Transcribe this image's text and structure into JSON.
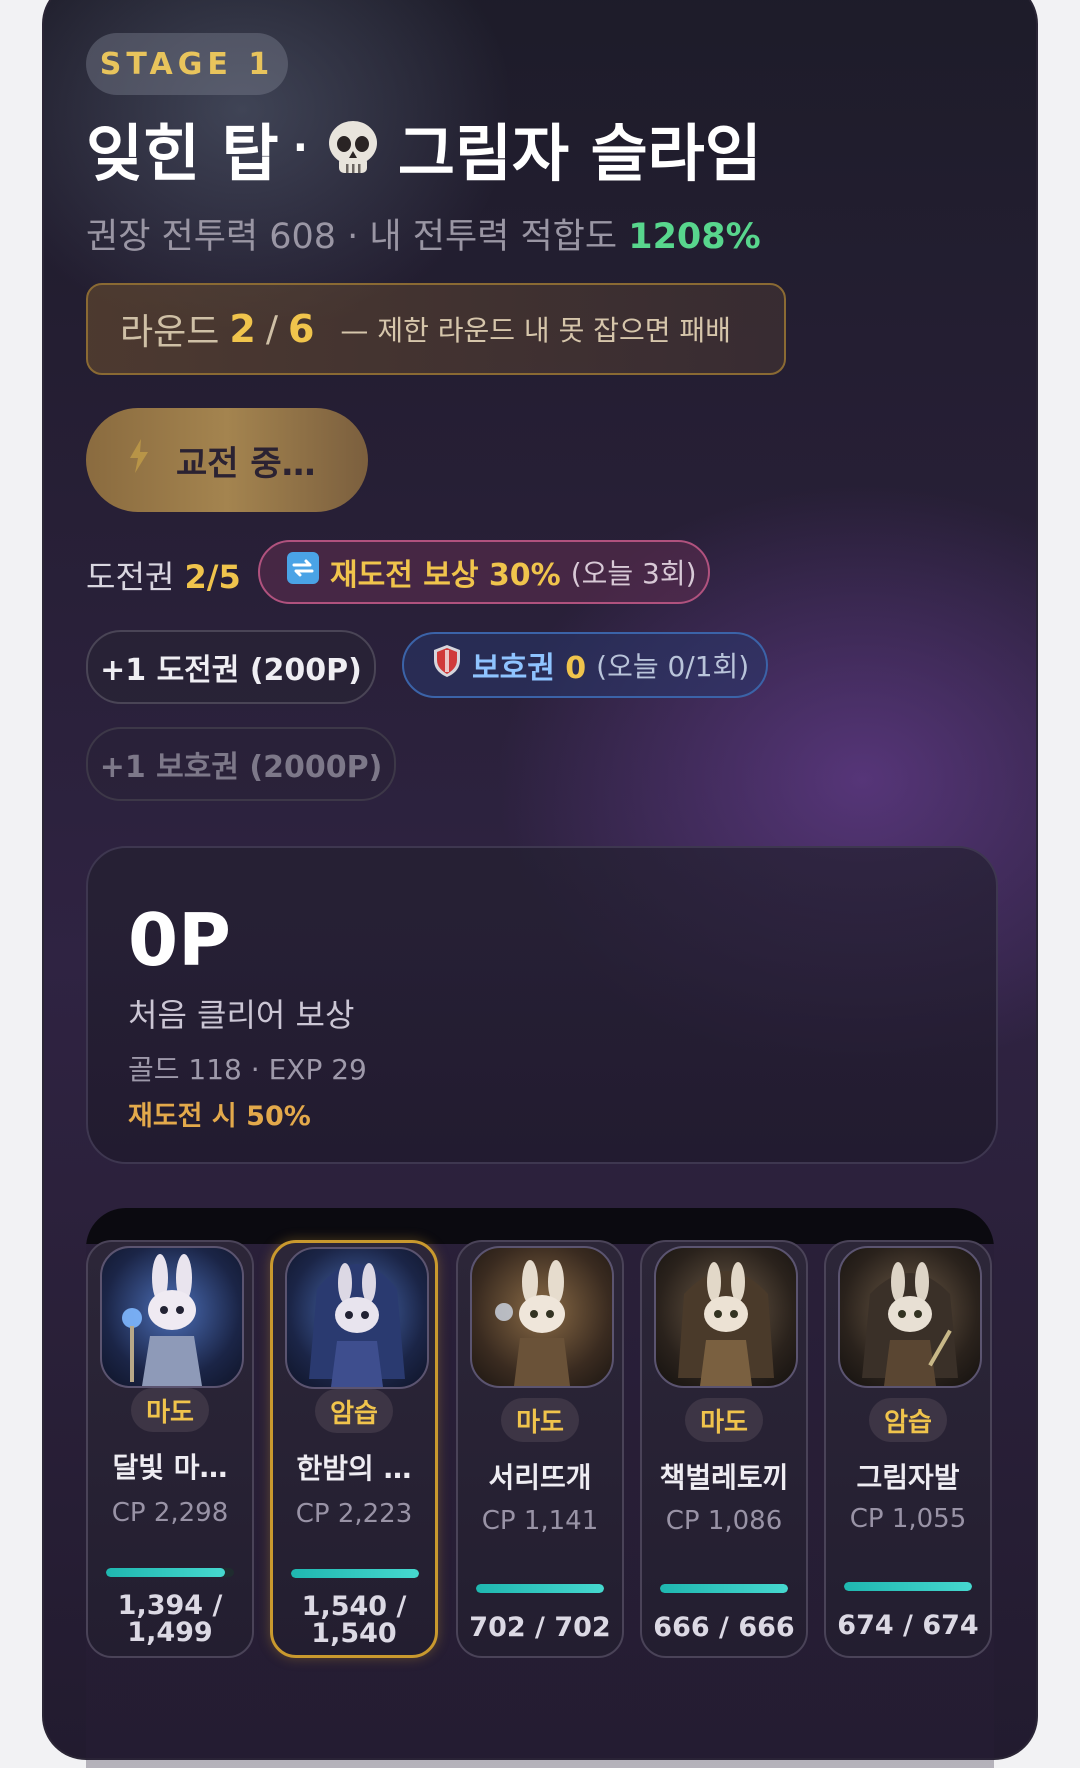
{
  "stage": {
    "badge": "STAGE 1"
  },
  "title": {
    "part1": "잊힌 탑",
    "separator": "·",
    "icon": "skull-icon",
    "part2": "그림자 슬라임"
  },
  "subtitle": {
    "text": "권장 전투력 608 · 내 전투력 적합도 ",
    "fit": "1208%"
  },
  "round": {
    "label": "라운드",
    "current": "2",
    "sep": "/",
    "max": "6",
    "note": "— 제한 라운드 내 못 잡으면 패배"
  },
  "battle_button": {
    "label": "교전 중…",
    "icon": "lightning-icon"
  },
  "tickets": {
    "label": "도전권",
    "value": "2/5"
  },
  "retry_reward": {
    "icon": "repeat-icon",
    "label": "재도전 보상 30%",
    "sub": "(오늘 3회)"
  },
  "buy_ticket": {
    "label": "+1 도전권 (200P)"
  },
  "guard": {
    "icon": "shield-icon",
    "label": "보호권",
    "value": "0",
    "sub": "(오늘 0/1회)"
  },
  "buy_guard": {
    "label": "+1 보호권 (2000P)"
  },
  "reward": {
    "points": "0P",
    "label": "처음 클리어 보상",
    "detail": "골드 118 · EXP 29",
    "retry": "재도전 시 50%"
  },
  "party": [
    {
      "role": "마도",
      "name": "달빛 마…",
      "cp": "CP 2,298",
      "hp": "1,394 /",
      "hp2": "1,499",
      "hp_ratio": 0.93
    },
    {
      "role": "암습",
      "name": "한밤의 …",
      "cp": "CP 2,223",
      "hp": "1,540 /",
      "hp2": "1,540",
      "hp_ratio": 1.0
    },
    {
      "role": "마도",
      "name": "서리뜨개",
      "cp": "CP 1,141",
      "hp": "702 / 702",
      "hp_ratio": 1.0
    },
    {
      "role": "마도",
      "name": "책벌레토끼",
      "cp": "CP 1,086",
      "hp": "666 / 666",
      "hp_ratio": 1.0
    },
    {
      "role": "암습",
      "name": "그림자발",
      "cp": "CP 1,055",
      "hp": "674 / 674",
      "hp_ratio": 1.0
    }
  ],
  "colors": {
    "accent_gold": "#f0c44c",
    "fit_green": "#58d68d",
    "hp_teal": "#2ec6bd",
    "guard_blue": "#8fc4ff"
  }
}
